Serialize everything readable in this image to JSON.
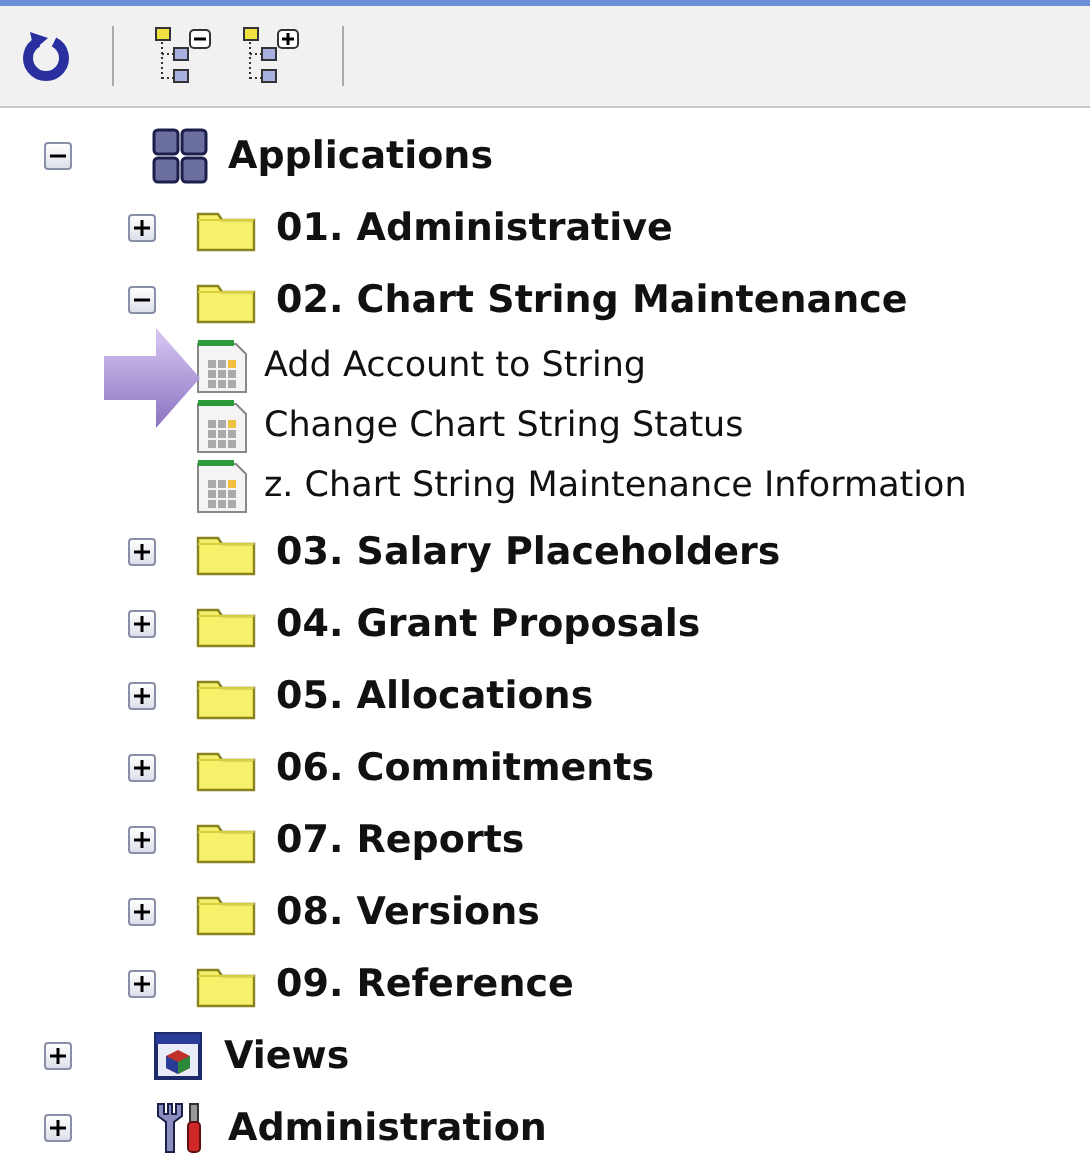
{
  "toolbar": {
    "buttons": [
      {
        "kind": "refresh"
      },
      {
        "kind": "collapse"
      },
      {
        "kind": "expand"
      }
    ]
  },
  "tree": [
    {
      "label": "Applications",
      "kind": "apps",
      "expanded": true,
      "children": [
        {
          "label": "01. Administrative",
          "kind": "folder",
          "expanded": false
        },
        {
          "label": "02. Chart String Maintenance",
          "kind": "folder",
          "expanded": true,
          "children": [
            {
              "label": "Add Account to String",
              "kind": "report",
              "pointed": true
            },
            {
              "label": "Change Chart String Status",
              "kind": "report",
              "pointed": false
            },
            {
              "label": "z. Chart String Maintenance Information",
              "kind": "report",
              "pointed": false
            }
          ]
        },
        {
          "label": "03. Salary Placeholders",
          "kind": "folder",
          "expanded": false
        },
        {
          "label": "04. Grant Proposals",
          "kind": "folder",
          "expanded": false
        },
        {
          "label": "05. Allocations",
          "kind": "folder",
          "expanded": false
        },
        {
          "label": "06. Commitments",
          "kind": "folder",
          "expanded": false
        },
        {
          "label": "07. Reports",
          "kind": "folder",
          "expanded": false
        },
        {
          "label": "08. Versions",
          "kind": "folder",
          "expanded": false
        },
        {
          "label": "09. Reference",
          "kind": "folder",
          "expanded": false
        }
      ]
    },
    {
      "label": "Views",
      "kind": "views",
      "expanded": false
    },
    {
      "label": "Administration",
      "kind": "tools",
      "expanded": false
    }
  ]
}
